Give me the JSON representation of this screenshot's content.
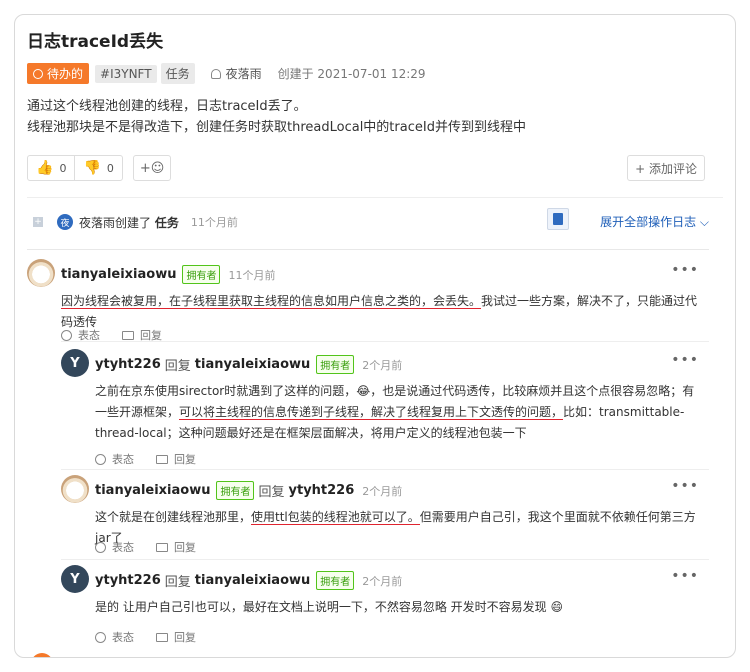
{
  "issue": {
    "title": "日志traceId丢失",
    "status": "待办的",
    "id": "#I3YNFT",
    "type": "任务",
    "author": "夜落雨",
    "created": "创建于  2021-07-01 12:29",
    "description": [
      "通过这个线程池创建的线程，日志traceId丢了。",
      "线程池那块是不是得改造下，创建任务时获取threadLocal中的traceId并传到到线程中"
    ]
  },
  "reactions": {
    "thumbs_up_count": "0",
    "thumbs_down_count": "0",
    "add_reaction": "+☺",
    "add_comment": "+ 添加评论"
  },
  "log": {
    "avatar_letter": "夜",
    "text_prefix": "夜落雨创建了 ",
    "text_type": "任务",
    "time": "11个月前",
    "expand": "展开全部操作日志  ⌵"
  },
  "comments": [
    {
      "user": "tianyaleixiaowu",
      "reply_word": "",
      "reply_to": "",
      "badge": "拥有者",
      "time": "11个月前",
      "body_pre": "",
      "body_ul": "因为线程会被复用，在子线程里获取主线程的信息如用户信息之类的，会丢失。",
      "body_post": "我试过一些方案，解决不了，只能通过代码透传",
      "react": "表态",
      "reply": "回复"
    },
    {
      "user": "ytyht226",
      "reply_word": "回复",
      "reply_to": "tianyaleixiaowu",
      "badge": "拥有者",
      "time": "2个月前",
      "body_pre": "之前在京东使用sirector时就遇到了这样的问题，😂，也是说通过代码透传，比较麻烦并且这个点很容易忽略；有一些开源框架，",
      "body_ul": "可以将主线程的信息传递到子线程，解决了线程复用上下文透传的问题，",
      "body_post": "比如：transmittable-thread-local；这种问题最好还是在框架层面解决，将用户定义的线程池包装一下",
      "react": "表态",
      "reply": "回复"
    },
    {
      "user": "tianyaleixiaowu",
      "reply_word": "回复",
      "reply_to": "ytyht226",
      "badge": "拥有者",
      "time": "2个月前",
      "body_pre": "这个就是在创建线程池那里，",
      "body_ul": "使用ttl包装的线程池就可以了。",
      "body_post": "但需要用户自己引，我这个里面就不依赖任何第三方jar了",
      "react": "表态",
      "reply": "回复"
    },
    {
      "user": "ytyht226",
      "reply_word": "回复",
      "reply_to": "tianyaleixiaowu",
      "badge": "拥有者",
      "time": "2个月前",
      "body_pre": "是的 让用户自己引也可以，最好在文档上说明一下，不然容易忽略 开发时不容易发现 😄",
      "body_ul": "",
      "body_post": "",
      "react": "表态",
      "reply": "回复"
    }
  ],
  "avatar_letter_y": "Y",
  "more_icon": "•••",
  "colors": {
    "status": "#f5792a",
    "link": "#1f5fb8",
    "underline": "#e0242f",
    "owner_badge": "#52c41a"
  }
}
